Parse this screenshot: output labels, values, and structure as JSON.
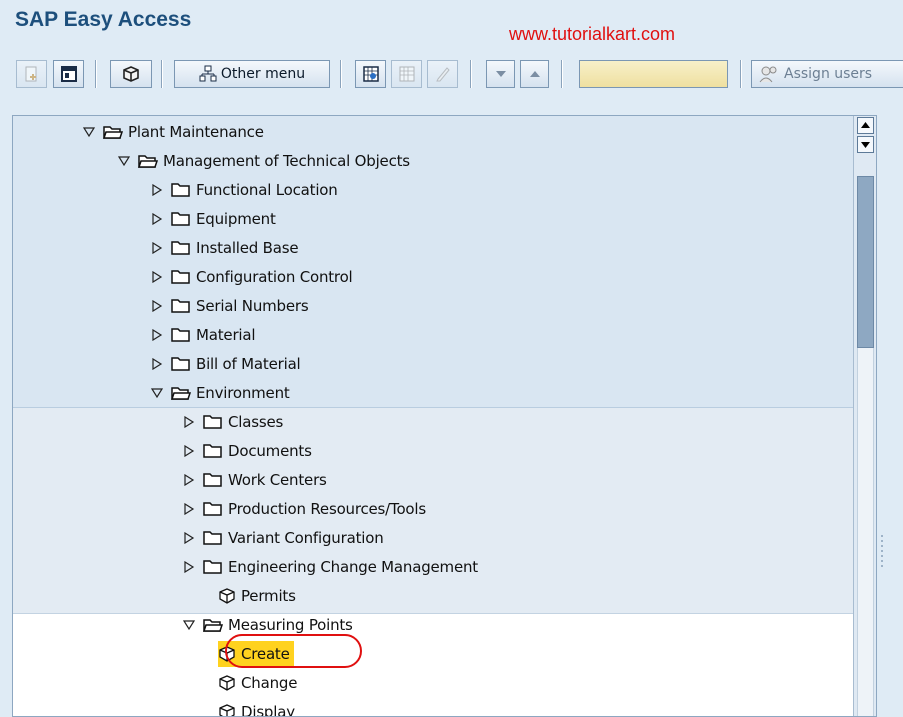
{
  "window": {
    "title": "SAP Easy Access",
    "watermark": "www.tutorialkart.com"
  },
  "toolbar": {
    "other_menu_label": "Other menu",
    "assign_users_label": "Assign users",
    "command_field_value": ""
  },
  "tree": {
    "nodes": [
      {
        "label": "Plant Maintenance",
        "type": "folder",
        "state": "expanded"
      },
      {
        "label": "Management of Technical Objects",
        "type": "folder",
        "state": "expanded"
      },
      {
        "label": "Functional Location",
        "type": "folder",
        "state": "collapsed"
      },
      {
        "label": "Equipment",
        "type": "folder",
        "state": "collapsed"
      },
      {
        "label": "Installed Base",
        "type": "folder",
        "state": "collapsed"
      },
      {
        "label": "Configuration Control",
        "type": "folder",
        "state": "collapsed"
      },
      {
        "label": "Serial Numbers",
        "type": "folder",
        "state": "collapsed"
      },
      {
        "label": "Material",
        "type": "folder",
        "state": "collapsed"
      },
      {
        "label": "Bill of Material",
        "type": "folder",
        "state": "collapsed"
      },
      {
        "label": "Environment",
        "type": "folder",
        "state": "expanded"
      },
      {
        "label": "Classes",
        "type": "folder",
        "state": "collapsed"
      },
      {
        "label": "Documents",
        "type": "folder",
        "state": "collapsed"
      },
      {
        "label": "Work Centers",
        "type": "folder",
        "state": "collapsed"
      },
      {
        "label": "Production Resources/Tools",
        "type": "folder",
        "state": "collapsed"
      },
      {
        "label": "Variant Configuration",
        "type": "folder",
        "state": "collapsed"
      },
      {
        "label": "Engineering Change Management",
        "type": "folder",
        "state": "collapsed"
      },
      {
        "label": "Permits",
        "type": "transaction",
        "state": "leaf"
      },
      {
        "label": "Measuring Points",
        "type": "folder",
        "state": "expanded"
      },
      {
        "label": "Create",
        "type": "transaction",
        "state": "selected"
      },
      {
        "label": "Change",
        "type": "transaction",
        "state": "leaf"
      },
      {
        "label": "Display",
        "type": "transaction",
        "state": "leaf"
      }
    ]
  },
  "colors": {
    "title": "#1d4f7c",
    "watermark": "#e01010",
    "selection": "#ffd21f",
    "annotation_circle": "#e01010"
  },
  "icons": {
    "expanded_toggle": "triangle-down-icon",
    "collapsed_toggle": "triangle-right-icon",
    "folder": "folder-icon",
    "open_folder": "open-folder-icon",
    "transaction": "cube-icon"
  }
}
